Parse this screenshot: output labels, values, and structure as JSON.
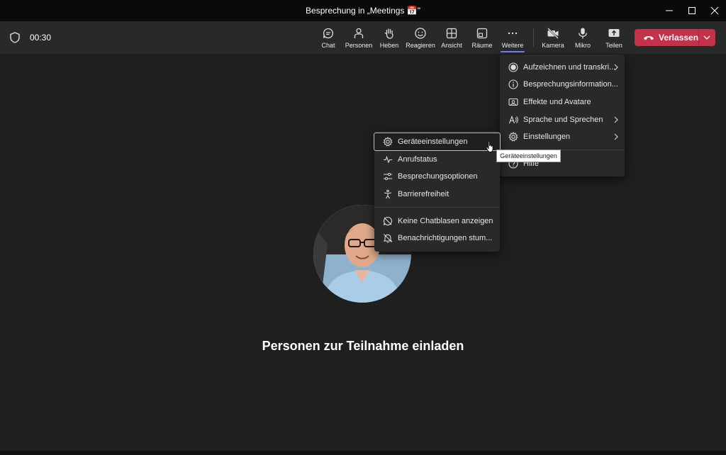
{
  "window": {
    "title": "Besprechung in „Meetings 📅\""
  },
  "call": {
    "timer": "00:30"
  },
  "toolbar": {
    "buttons": [
      {
        "id": "chat",
        "label": "Chat"
      },
      {
        "id": "people",
        "label": "Personen"
      },
      {
        "id": "raise",
        "label": "Heben"
      },
      {
        "id": "react",
        "label": "Reagieren"
      },
      {
        "id": "view",
        "label": "Ansicht"
      },
      {
        "id": "rooms",
        "label": "Räume"
      },
      {
        "id": "more",
        "label": "Weitere"
      },
      {
        "id": "camera",
        "label": "Kamera"
      },
      {
        "id": "mic",
        "label": "Mikro"
      },
      {
        "id": "share",
        "label": "Teilen"
      }
    ],
    "leave_label": "Verlassen"
  },
  "more_menu": {
    "items": [
      {
        "label": "Aufzeichnen und transkri..."
      },
      {
        "label": "Besprechungsinformation..."
      },
      {
        "label": "Effekte und Avatare"
      },
      {
        "label": "Sprache und Sprechen"
      },
      {
        "label": "Einstellungen"
      },
      {
        "label": "Hilfe"
      }
    ]
  },
  "settings_menu": {
    "items": [
      {
        "label": "Geräteeinstellungen"
      },
      {
        "label": "Anrufstatus"
      },
      {
        "label": "Besprechungsoptionen"
      },
      {
        "label": "Barrierefreiheit"
      },
      {
        "label": "Keine Chatblasen anzeigen"
      },
      {
        "label": "Benachrichtigungen stum..."
      }
    ]
  },
  "tooltip": "Geräteeinstellungen",
  "stage": {
    "invite_text": "Personen zur Teilnahme einladen"
  },
  "colors": {
    "leave": "#c4314b",
    "accent": "#7f85f5",
    "background": "#1f1f1f"
  }
}
